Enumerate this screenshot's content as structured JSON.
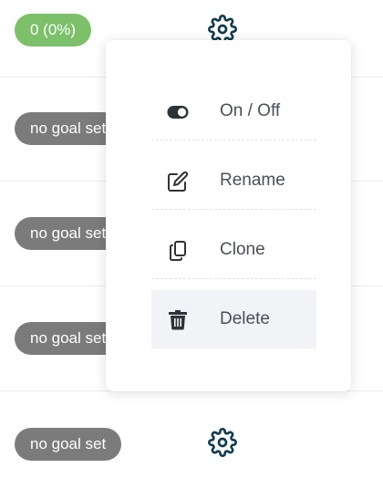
{
  "rows": [
    {
      "badge": "0 (0%)",
      "badge_color": "#7cc06a"
    },
    {
      "badge": "no goal set",
      "badge_color": "#7b7b7b"
    },
    {
      "badge": "no goal set",
      "badge_color": "#7b7b7b"
    },
    {
      "badge": "no goal set",
      "badge_color": "#7b7b7b"
    },
    {
      "badge": "no goal set",
      "badge_color": "#7b7b7b"
    }
  ],
  "row_icon": "gear-icon",
  "menu": {
    "items": [
      {
        "label": "On / Off",
        "icon": "toggle-icon"
      },
      {
        "label": "Rename",
        "icon": "edit-icon"
      },
      {
        "label": "Clone",
        "icon": "copy-icon"
      },
      {
        "label": "Delete",
        "icon": "trash-icon"
      }
    ],
    "active_item": "Delete"
  },
  "colors": {
    "icon": "#123a4e",
    "menu_text": "#4a4f57",
    "active_bg": "#f2f3f7"
  }
}
